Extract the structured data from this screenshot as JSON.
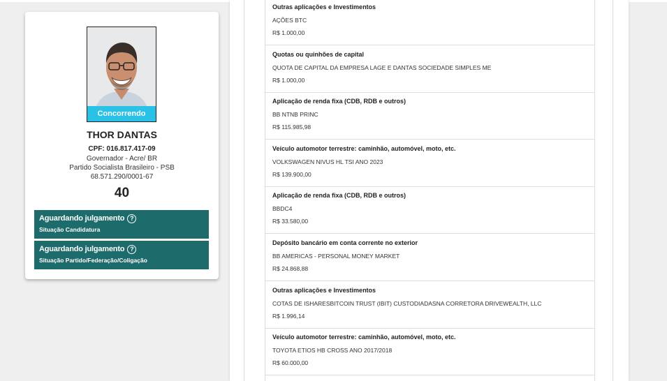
{
  "candidate": {
    "photo_badge": "Concorrendo",
    "name": "THOR DANTAS",
    "cpf": "CPF: 016.817.417-09",
    "role": "Governador - Acre/ BR",
    "party": "Partido Socialista Brasileiro - PSB",
    "cnpj": "68.571.290/0001-67",
    "number": "40"
  },
  "status": [
    {
      "title": "Aguardando julgamento",
      "subtitle": "Situação Candidatura",
      "icon": "help-circle-icon"
    },
    {
      "title": "Aguardando julgamento",
      "subtitle": "Situação Partido/Federação/Coligação",
      "icon": "help-circle-icon"
    }
  ],
  "assets": [
    {
      "type": "Outras aplicações e Investimentos",
      "description": "AÇÕES BTC",
      "value": "R$ 1.000,00"
    },
    {
      "type": "Quotas ou quinhões de capital",
      "description": "QUOTA DE CAPITAL DA EMPRESA LAGE E DANTAS SOCIEDADE SIMPLES ME",
      "value": "R$ 1.000,00"
    },
    {
      "type": "Aplicação de renda fixa (CDB, RDB e outros)",
      "description": "BB NTNB PRINC",
      "value": "R$ 115.985,98"
    },
    {
      "type": "Veículo automotor terrestre: caminhão, automóvel, moto, etc.",
      "description": "VOLKSWAGEN NIVUS HL TSI ANO 2023",
      "value": "R$ 139.900,00"
    },
    {
      "type": "Aplicação de renda fixa (CDB, RDB e outros)",
      "description": "BBDC4",
      "value": "R$ 33.580,00"
    },
    {
      "type": "Depósito bancário em conta corrente no exterior",
      "description": "BB AMERICAS - PERSONAL MONEY MARKET",
      "value": "R$ 24.868,88"
    },
    {
      "type": "Outras aplicações e Investimentos",
      "description": "COTAS DE ISHARESBITCOIN TRUST (IBIT) CUSTODIADASNA CORRETORA DRIVEWEALTH, LLC",
      "value": "R$ 1.996,14"
    },
    {
      "type": "Veículo automotor terrestre: caminhão, automóvel, moto, etc.",
      "description": "TOYOTA ETIOS HB CROSS ANO 2017/2018",
      "value": "R$ 60.000,00"
    }
  ]
}
